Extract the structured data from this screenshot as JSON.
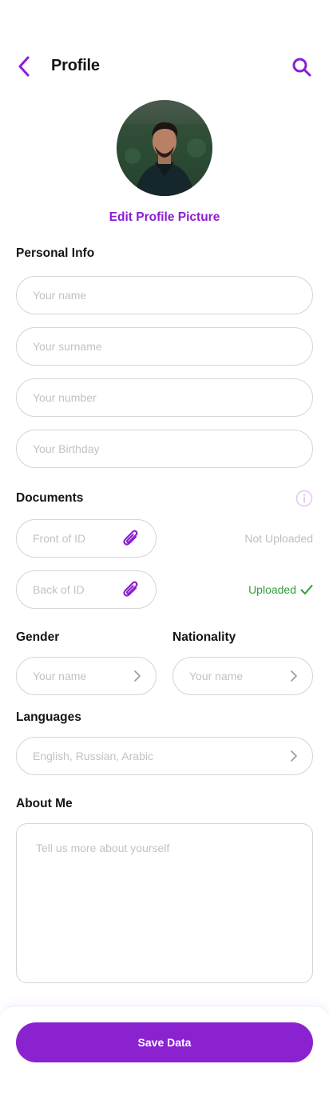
{
  "header": {
    "title": "Profile",
    "back_icon": "chevron-left-icon",
    "search_icon": "search-icon",
    "accent_color": "#8a1fd1"
  },
  "profile": {
    "edit_picture_label": "Edit Profile Picture"
  },
  "personal_info": {
    "title": "Personal Info",
    "fields": [
      {
        "placeholder": "Your name",
        "value": ""
      },
      {
        "placeholder": "Your surname",
        "value": ""
      },
      {
        "placeholder": "Your number",
        "value": ""
      },
      {
        "placeholder": "Your Birthday",
        "value": ""
      }
    ]
  },
  "documents": {
    "title": "Documents",
    "items": [
      {
        "label": "Front of ID",
        "status": "Not Uploaded",
        "uploaded": false
      },
      {
        "label": "Back of ID",
        "status": "Uploaded",
        "uploaded": true
      }
    ]
  },
  "gender": {
    "title": "Gender",
    "placeholder": "Your name"
  },
  "nationality": {
    "title": "Nationality",
    "placeholder": "Your name"
  },
  "languages": {
    "title": "Languages",
    "placeholder": "English, Russian, Arabic"
  },
  "about": {
    "title": "About Me",
    "placeholder": "Tell us more about yourself"
  },
  "actions": {
    "save_label": "Save Data",
    "save_color": "#8a22cf",
    "success_color": "#2e9c3a"
  }
}
